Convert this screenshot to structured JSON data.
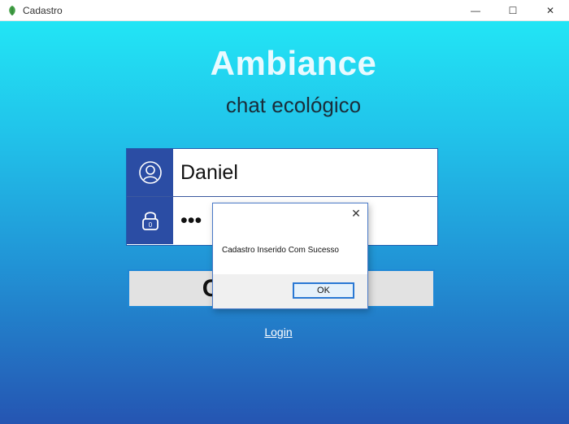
{
  "window": {
    "title": "Cadastro",
    "controls": {
      "minimize": "—",
      "maximize": "☐",
      "close": "✕"
    }
  },
  "header": {
    "app_name": "Ambiance",
    "subtitle": "chat ecológico"
  },
  "form": {
    "username_value": "Daniel",
    "password_value": "•••",
    "user_icon": "user-icon",
    "lock_icon": "lock-icon"
  },
  "actions": {
    "register_label": "CADASTRAR",
    "login_link": "Login"
  },
  "dialog": {
    "message": "Cadastro Inserido Com Sucesso",
    "ok_label": "OK",
    "close_glyph": "✕"
  },
  "colors": {
    "gradient_top": "#22e5f5",
    "gradient_bottom": "#2555b2",
    "icon_panel": "#2b4da4",
    "accent": "#1e88d6"
  }
}
